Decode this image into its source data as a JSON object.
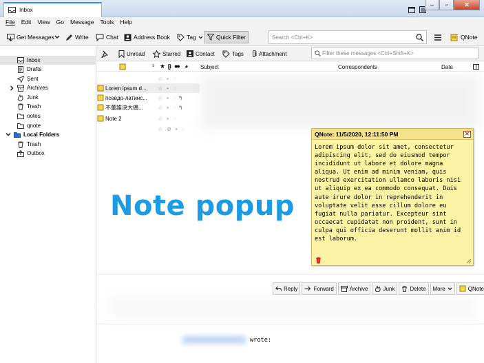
{
  "window": {
    "tab_title": "Inbox"
  },
  "menubar": [
    "File",
    "Edit",
    "View",
    "Go",
    "Message",
    "Tools",
    "Help"
  ],
  "toolbar": {
    "get_messages": "Get Messages",
    "write": "Write",
    "chat": "Chat",
    "address_book": "Address Book",
    "tag": "Tag",
    "quick_filter": "Quick Filter",
    "search_placeholder": "Search <Ctrl+K>",
    "qnote": "QNote"
  },
  "folders": {
    "account": [
      {
        "label": "Inbox",
        "selected": true
      },
      {
        "label": "Drafts"
      },
      {
        "label": "Sent"
      },
      {
        "label": "Archives",
        "expandable": true
      },
      {
        "label": "Junk"
      },
      {
        "label": "Trash"
      },
      {
        "label": "notes"
      },
      {
        "label": "qnote"
      }
    ],
    "local_root": "Local Folders",
    "local": [
      {
        "label": "Trash"
      },
      {
        "label": "Outbox"
      }
    ]
  },
  "quickfilter": {
    "unread": "Unread",
    "starred": "Starred",
    "contact": "Contact",
    "tags": "Tags",
    "attachment": "Attachment",
    "filter_placeholder": "Filter these messages <Ctrl+Shift+K>"
  },
  "thread_columns": {
    "subject": "Subject",
    "correspondents": "Correspondents",
    "date": "Date"
  },
  "messages": [
    {
      "subject": "Lorem ipsum d..."
    },
    {
      "subject": "псевдо-латинс..."
    },
    {
      "subject": "不董誰決大僑..."
    },
    {
      "subject": "Note 2"
    }
  ],
  "overlay_text": "Note popup",
  "note": {
    "title": "QNote: 11/5/2020, 12:11:50 PM",
    "body": "Lorem ipsum dolor sit amet, consectetur\nadipiscing elit, sed do eiusmod tempor\nincididunt ut labore et dolore magna\naliqua. Ut enim ad minim veniam, quis\nnostrud exercitation ullamco laboris nisi\nut aliquip ex ea commodo consequat. Duis\naute irure dolor in reprehenderit in\nvoluptate velit esse cillum dolore eu\nfugiat nulla pariatur. Excepteur sint\noccaecat cupidatat non proident, sunt in\nculpa qui officia deserunt mollit anim id\nest laborum."
  },
  "message_actions": {
    "reply": "Reply",
    "forward": "Forward",
    "archive": "Archive",
    "junk": "Junk",
    "delete": "Delete",
    "more": "More",
    "qnote": "QNote"
  },
  "message_body": {
    "wrote": "wrote:"
  },
  "colors": {
    "accent": "#1e9be5",
    "note_bg": "#fbf2a3",
    "reply_arrow": "#8a3fb3"
  }
}
